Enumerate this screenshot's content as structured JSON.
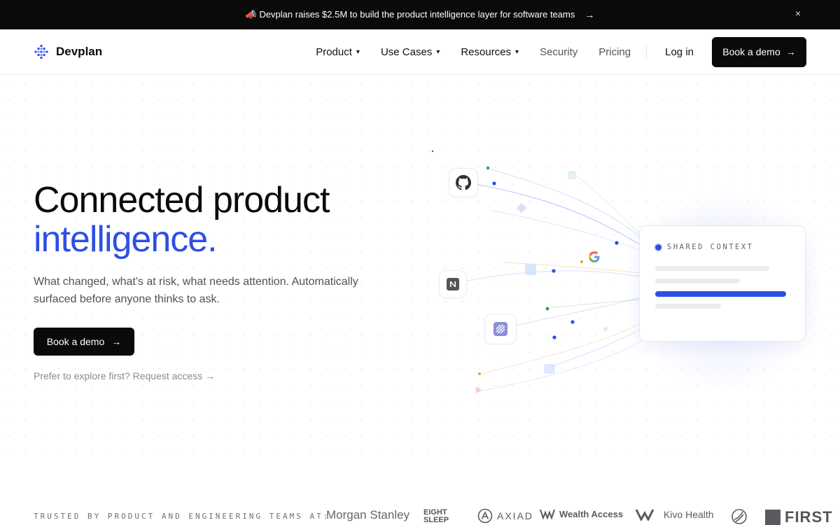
{
  "announcement": {
    "text": "📣 Devplan raises $2.5M to build the product intelligence layer for software teams",
    "arrow": "→",
    "close": "×"
  },
  "nav": {
    "brand": "Devplan",
    "items": [
      {
        "label": "Product",
        "caret": "▾"
      },
      {
        "label": "Use Cases",
        "caret": "▾"
      },
      {
        "label": "Resources",
        "caret": "▾"
      },
      {
        "label": "Security"
      },
      {
        "label": "Pricing"
      }
    ],
    "login": "Log in",
    "cta": "Book a demo",
    "cta_arrow": "→"
  },
  "hero": {
    "title_line1": "Connected product",
    "title_line2": "intelligence.",
    "subtitle": "What changed, what's at risk, what needs attention. Automatically surfaced before anyone thinks to ask.",
    "cta": "Book a demo",
    "cta_arrow": "→",
    "alt_link": "Prefer to explore first? Request access →"
  },
  "illustration": {
    "card_label": "SHARED CONTEXT",
    "sources": [
      "github-icon",
      "notion-icon",
      "linear-icon",
      "google-icon"
    ]
  },
  "trusted": {
    "label": "TRUSTED BY PRODUCT AND ENGINEERING TEAMS AT:",
    "logos": [
      "Morgan Stanley",
      "EIGHT SLEEP",
      "AXIAD",
      "Wealth Access",
      "Kivo Health",
      "FIRST"
    ]
  },
  "colors": {
    "accent": "#2d4fe6",
    "dark": "#0a0a0a"
  }
}
